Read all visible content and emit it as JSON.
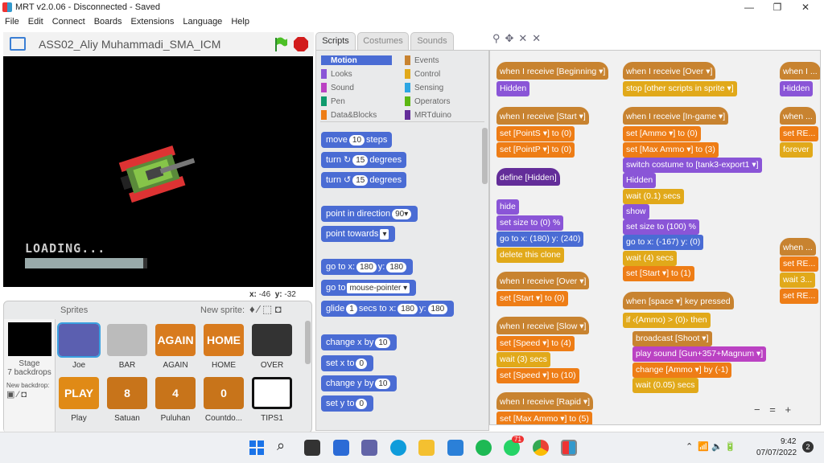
{
  "window": {
    "title": "MRT v2.0.06 - Disconnected - Saved",
    "minimize": "—",
    "maximize": "❐",
    "close": "✕"
  },
  "menu": [
    "File",
    "Edit",
    "Connect",
    "Boards",
    "Extensions",
    "Language",
    "Help"
  ],
  "stage": {
    "project_name": "ASS02_Aliy Muhammadi_SMA_ICM",
    "loading_text": "LOADING...",
    "loading_progress": 0.97,
    "coord_x_label": "x:",
    "coord_x": "-46",
    "coord_y_label": "y:",
    "coord_y": "-32"
  },
  "sprites": {
    "header": "Sprites",
    "new_sprite_label": "New sprite:",
    "stage_label": "Stage",
    "backdrops_label": "7 backdrops",
    "new_backdrop_label": "New backdrop:",
    "items": [
      {
        "name": "Joe",
        "text": ""
      },
      {
        "name": "BAR",
        "text": ""
      },
      {
        "name": "AGAIN",
        "text": "AGAIN"
      },
      {
        "name": "HOME",
        "text": "HOME"
      },
      {
        "name": "OVER",
        "text": ""
      },
      {
        "name": "Play",
        "text": "PLAY"
      },
      {
        "name": "Satuan",
        "text": "8"
      },
      {
        "name": "Puluhan",
        "text": "4"
      },
      {
        "name": "Countdo...",
        "text": "0"
      },
      {
        "name": "TIPS1",
        "text": ""
      }
    ]
  },
  "tabs": [
    "Scripts",
    "Costumes",
    "Sounds"
  ],
  "categories": [
    {
      "label": "Motion",
      "color": "#4a6cd4"
    },
    {
      "label": "Events",
      "color": "#c88330"
    },
    {
      "label": "Looks",
      "color": "#8a55d7"
    },
    {
      "label": "Control",
      "color": "#e1a91a"
    },
    {
      "label": "Sound",
      "color": "#bb42c3"
    },
    {
      "label": "Sensing",
      "color": "#2ca5e2"
    },
    {
      "label": "Pen",
      "color": "#0e9a6c"
    },
    {
      "label": "Operators",
      "color": "#5cb712"
    },
    {
      "label": "Data&Blocks",
      "color": "#ee7d16"
    },
    {
      "label": "MRTduino",
      "color": "#632d99"
    }
  ],
  "palette": {
    "move": "move",
    "move_val": "10",
    "steps": "steps",
    "turn": "turn",
    "turn_val": "15",
    "degrees": "degrees",
    "point_dir": "point in direction",
    "point_dir_val": "90▾",
    "point_towards": "point towards",
    "goto": "go to x:",
    "goto_x": "180",
    "y_lbl": "y:",
    "goto_y": "180",
    "goto_mp": "go to",
    "mp": "mouse-pointer ▾",
    "glide": "glide",
    "glide_s": "1",
    "secs_to": "secs to x:",
    "glide_x": "180",
    "glide_y": "180",
    "chx": "change x by",
    "chx_v": "10",
    "setx": "set x to",
    "setx_v": "0",
    "chy": "change y by",
    "chy_v": "10",
    "sety": "set y to",
    "sety_v": "0"
  },
  "zoom_minus": "−",
  "zoom_reset": "=",
  "zoom_plus": "+",
  "taskbar": {
    "time": "9:42",
    "date": "07/07/2022",
    "badge_whatsapp": "71",
    "notif": "2"
  }
}
